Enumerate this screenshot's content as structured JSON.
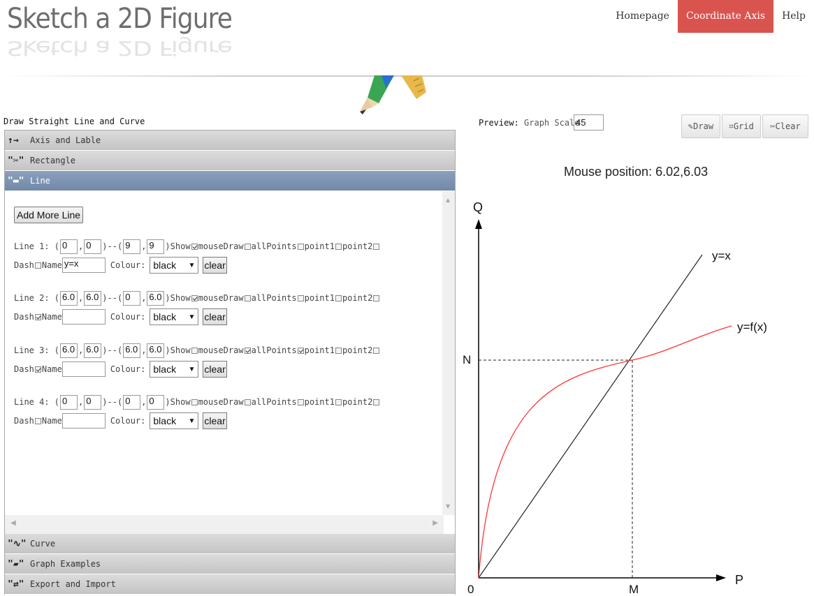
{
  "header": {
    "logo_text": "Sketch a 2D Figure",
    "nav": [
      {
        "label": "Homepage"
      },
      {
        "label": "Coordinate Axis",
        "active": true
      },
      {
        "label": "Help"
      }
    ],
    "accent_color": "#d9534f"
  },
  "left_panel": {
    "title": "Draw Straight Line and Curve",
    "sections": {
      "axis": {
        "icon": "arrows-icon",
        "glyph": "↑→",
        "label": "Axis and Lable"
      },
      "rectangle": {
        "icon": "scissors-icon",
        "glyph": "\"✂\"",
        "label": "Rectangle"
      },
      "line": {
        "icon": "line-icon",
        "glyph": "\"▬\"",
        "label": "Line"
      },
      "curve": {
        "icon": "curve-icon",
        "glyph": "\"∿\"",
        "label": "Curve"
      },
      "examples": {
        "icon": "folder-icon",
        "glyph": "\"▰\"",
        "label": "Graph Examples"
      },
      "export": {
        "icon": "retweet-icon",
        "glyph": "\"⇄\"",
        "label": "Export and Import"
      }
    },
    "add_line_label": "Add More Line",
    "text": {
      "dash": "--",
      "comma": ",",
      "show": "Show",
      "mouse_draw": "mouseDraw",
      "all_points": "allPoints",
      "point1": "point1",
      "point2": "point2",
      "dash_label": "Dash",
      "name_label": "Name",
      "colour_label": "Colour:",
      "clear_label": "clear"
    },
    "lines": [
      {
        "label": "Line 1:",
        "x1": "0",
        "y1": "0",
        "x2": "9",
        "y2": "9",
        "show": true,
        "mouseDraw": false,
        "allPoints": false,
        "point1": false,
        "point2": false,
        "dash": false,
        "name": "y=x",
        "colour": "black"
      },
      {
        "label": "Line 2:",
        "x1": "6.0",
        "y1": "6.0",
        "x2": "0",
        "y2": "6.0",
        "show": true,
        "mouseDraw": false,
        "allPoints": false,
        "point1": false,
        "point2": false,
        "dash": true,
        "name": "",
        "colour": "black"
      },
      {
        "label": "Line 3:",
        "x1": "6.0",
        "y1": "6.0",
        "x2": "6.0",
        "y2": "6.0",
        "show": false,
        "mouseDraw": true,
        "allPoints": true,
        "point1": false,
        "point2": false,
        "dash": true,
        "name": "",
        "colour": "black"
      },
      {
        "label": "Line 4:",
        "x1": "0",
        "y1": "0",
        "x2": "0",
        "y2": "0",
        "show": false,
        "mouseDraw": false,
        "allPoints": false,
        "point1": false,
        "point2": false,
        "dash": false,
        "name": "",
        "colour": "black"
      }
    ]
  },
  "preview": {
    "label": "Preview:",
    "scale_label": "Graph Scale",
    "scale_value": "45",
    "buttons": {
      "draw": "Draw",
      "grid": "Grid",
      "clear": "Clear"
    },
    "mouse_position": "Mouse position: 6.02,6.03",
    "graph": {
      "labels": {
        "y_axis": "Q",
        "x_axis": "P",
        "origin": "0",
        "n": "N",
        "m": "M",
        "line_label": "y=x",
        "curve_label": "y=f(x)"
      },
      "curve_color": "#ff3333",
      "line_color": "#222222"
    }
  }
}
